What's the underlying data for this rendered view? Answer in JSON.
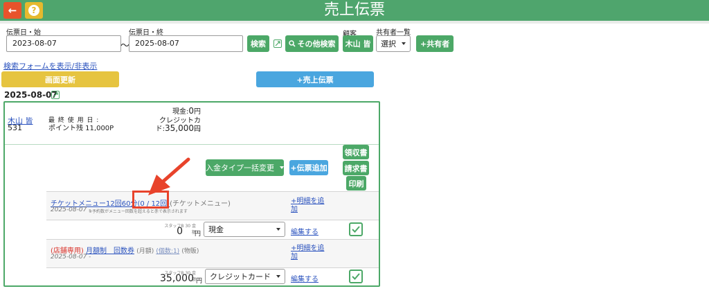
{
  "header": {
    "title": "売上伝票",
    "back_icon": "←",
    "help_icon": "?",
    "colors": {
      "header": "#4fa56d",
      "back": "#e8532b",
      "help": "#e6b92e"
    }
  },
  "search": {
    "start_label": "伝票日・始",
    "start_value": "2023-08-07",
    "tilde": "〜",
    "end_label": "伝票日・終",
    "end_value": "2025-08-07",
    "search_button": "検索",
    "other_search_button": "その他検索",
    "customer_label": "顧客",
    "customer_button": "木山 皆",
    "sharer_label": "共有者一覧",
    "sharer_select": "選択",
    "add_sharer_button": "+共有者",
    "toggle_link": "検索フォームを表示/非表示"
  },
  "actions": {
    "refresh_button": "画面更新",
    "new_slip_button": "+売上伝票",
    "colors": {
      "refresh": "#e6c440",
      "new_slip": "#4aa6df"
    }
  },
  "slip": {
    "date": "2025-08-07",
    "customer_name": "木山 皆",
    "customer_id": "531",
    "last_used_label": "最 終 使 用 日 :",
    "points": "ポイント残 11,000P",
    "cash_label": "現金:",
    "cash_value": "0",
    "cash_unit": "円",
    "credit_label": "クレジットカー",
    "credit_label2": "ド:",
    "credit_value": "35,000",
    "credit_unit": "円",
    "payment_bulk_button": "入金タイプ一括変更",
    "add_slip_button": "+伝票追加",
    "receipt_button": "領収書",
    "invoice_button": "請求書",
    "print_button": "印刷",
    "items": [
      {
        "name": "チケットメニュー12回60分",
        "count": "(0 / 12回)",
        "category": "(チケットメニュー)",
        "date": "2025-08-07 -",
        "note": "※予約数がメニュー回数を超えると赤で表示されます",
        "staff_label": "スタッフB 30 金額",
        "amount": "0",
        "unit": "円",
        "payment": "現金",
        "add_detail": "+明細を追加",
        "edit": "編集する"
      },
      {
        "prefix": "(店舗専用)",
        "name": "月額制　回数券",
        "type": "(月額)",
        "count_label": "(個数:1)",
        "category": "(物販)",
        "date": "2025-08-07 -",
        "staff_label": "スタッフB 30 金額",
        "amount": "35,000",
        "unit": "円",
        "payment": "クレジットカード",
        "add_detail": "+明細を追加",
        "edit": "編集する"
      }
    ]
  }
}
